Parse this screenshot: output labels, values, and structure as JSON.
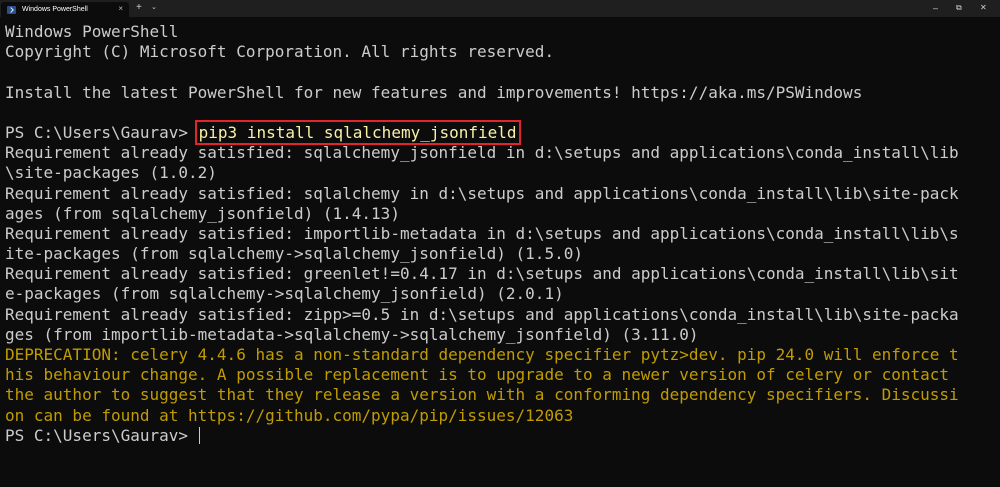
{
  "window": {
    "tab_title": "Windows PowerShell",
    "tab_close": "×",
    "new_tab": "+",
    "dropdown": "⌄",
    "minimize": "–",
    "maximize": "⧉",
    "close": "✕"
  },
  "terminal": {
    "banner_title": "Windows PowerShell",
    "copyright": "Copyright (C) Microsoft Corporation. All rights reserved.",
    "install_hint": "Install the latest PowerShell for new features and improvements! https://aka.ms/PSWindows",
    "prompt": "PS C:\\Users\\Gaurav> ",
    "command": "pip3 install sqlalchemy_jsonfield",
    "output": [
      "Requirement already satisfied: sqlalchemy_jsonfield in d:\\setups and applications\\conda_install\\lib",
      "\\site-packages (1.0.2)",
      "Requirement already satisfied: sqlalchemy in d:\\setups and applications\\conda_install\\lib\\site-pack",
      "ages (from sqlalchemy_jsonfield) (1.4.13)",
      "Requirement already satisfied: importlib-metadata in d:\\setups and applications\\conda_install\\lib\\s",
      "ite-packages (from sqlalchemy->sqlalchemy_jsonfield) (1.5.0)",
      "Requirement already satisfied: greenlet!=0.4.17 in d:\\setups and applications\\conda_install\\lib\\sit",
      "e-packages (from sqlalchemy->sqlalchemy_jsonfield) (2.0.1)",
      "Requirement already satisfied: zipp>=0.5 in d:\\setups and applications\\conda_install\\lib\\site-packa",
      "ges (from importlib-metadata->sqlalchemy->sqlalchemy_jsonfield) (3.11.0)"
    ],
    "deprecation": [
      "DEPRECATION: celery 4.4.6 has a non-standard dependency specifier pytz>dev. pip 24.0 will enforce t",
      "his behaviour change. A possible replacement is to upgrade to a newer version of celery or contact",
      "the author to suggest that they release a version with a conforming dependency specifiers. Discussi",
      "on can be found at https://github.com/pypa/pip/issues/12063"
    ],
    "final_prompt": "PS C:\\Users\\Gaurav> "
  },
  "colors": {
    "background": "#0c0c0c",
    "text": "#cccccc",
    "command": "#f9f1a5",
    "warning": "#c19c00",
    "highlight_box": "#e3242b"
  }
}
